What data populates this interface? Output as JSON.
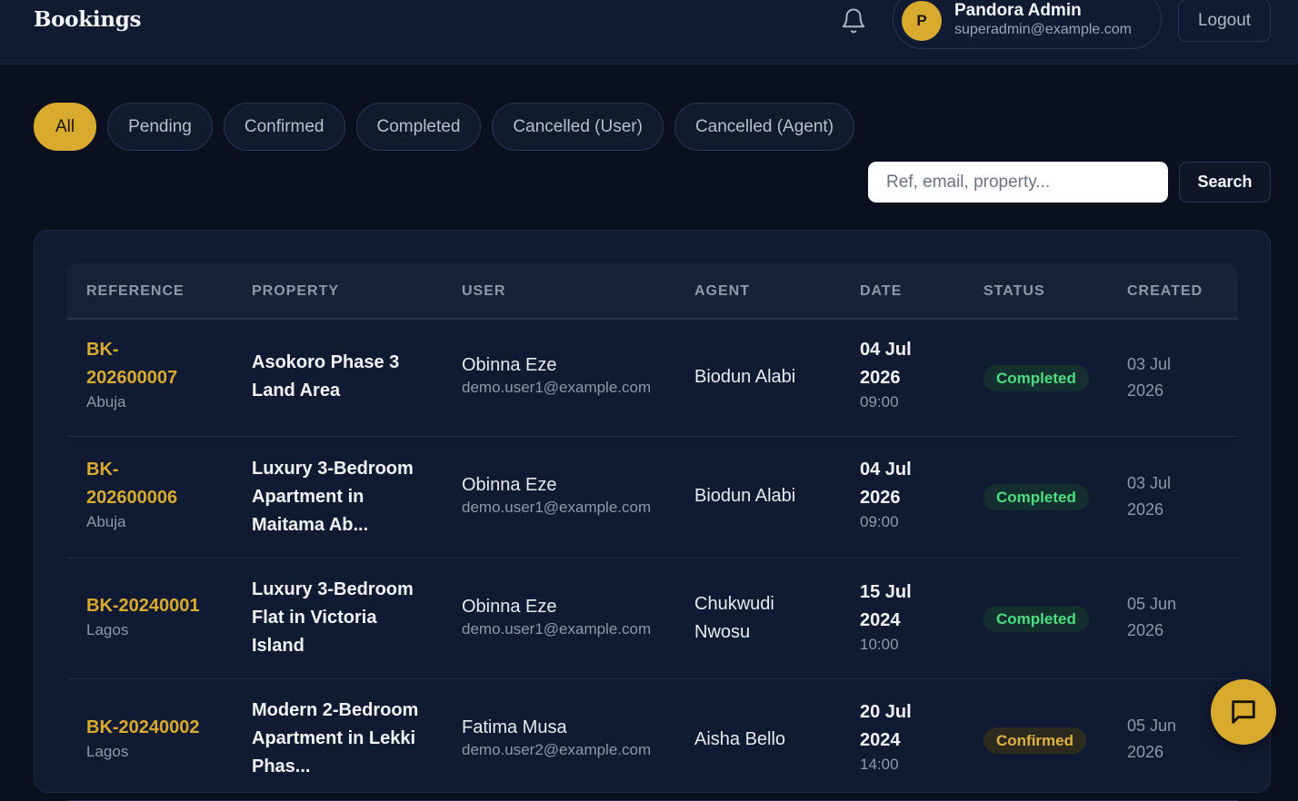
{
  "header": {
    "title": "Bookings",
    "user": {
      "initial": "P",
      "name": "Pandora Admin",
      "email": "superadmin@example.com"
    },
    "logout_label": "Logout"
  },
  "filters": {
    "tabs": [
      {
        "label": "All",
        "active": true
      },
      {
        "label": "Pending",
        "active": false
      },
      {
        "label": "Confirmed",
        "active": false
      },
      {
        "label": "Completed",
        "active": false
      },
      {
        "label": "Cancelled (User)",
        "active": false
      },
      {
        "label": "Cancelled (Agent)",
        "active": false
      }
    ]
  },
  "search": {
    "placeholder": "Ref, email, property...",
    "value": "",
    "button_label": "Search"
  },
  "table": {
    "columns": [
      "REFERENCE",
      "PROPERTY",
      "USER",
      "AGENT",
      "DATE",
      "STATUS",
      "CREATED"
    ],
    "rows": [
      {
        "ref_line1": "BK-",
        "ref_line2": "202600007",
        "city": "Abuja",
        "property_line1": "Asokoro Phase 3",
        "property_line2": "Land Area",
        "property_line3": "",
        "user_name": "Obinna Eze",
        "user_email": "demo.user1@example.com",
        "agent_line1": "Biodun Alabi",
        "agent_line2": "",
        "date_line1": "04 Jul",
        "date_line2": "2026",
        "time": "09:00",
        "status": "Completed",
        "created_line1": "03 Jul",
        "created_line2": "2026"
      },
      {
        "ref_line1": "BK-",
        "ref_line2": "202600006",
        "city": "Abuja",
        "property_line1": "Luxury 3-Bedroom",
        "property_line2": "Apartment in",
        "property_line3": "Maitama Ab...",
        "user_name": "Obinna Eze",
        "user_email": "demo.user1@example.com",
        "agent_line1": "Biodun Alabi",
        "agent_line2": "",
        "date_line1": "04 Jul",
        "date_line2": "2026",
        "time": "09:00",
        "status": "Completed",
        "created_line1": "03 Jul",
        "created_line2": "2026"
      },
      {
        "ref_line1": "BK-20240001",
        "ref_line2": "",
        "city": "Lagos",
        "property_line1": "Luxury 3-Bedroom",
        "property_line2": "Flat in Victoria",
        "property_line3": "Island",
        "user_name": "Obinna Eze",
        "user_email": "demo.user1@example.com",
        "agent_line1": "Chukwudi",
        "agent_line2": "Nwosu",
        "date_line1": "15 Jul",
        "date_line2": "2024",
        "time": "10:00",
        "status": "Completed",
        "created_line1": "05 Jun",
        "created_line2": "2026"
      },
      {
        "ref_line1": "BK-20240002",
        "ref_line2": "",
        "city": "Lagos",
        "property_line1": "Modern 2-Bedroom",
        "property_line2": "Apartment in Lekki",
        "property_line3": "Phas...",
        "user_name": "Fatima Musa",
        "user_email": "demo.user2@example.com",
        "agent_line1": "Aisha Bello",
        "agent_line2": "",
        "date_line1": "20 Jul",
        "date_line2": "2024",
        "time": "14:00",
        "status": "Confirmed",
        "created_line1": "05 Jun",
        "created_line2": "2026"
      }
    ]
  },
  "icons": {
    "notifications": "bell-icon",
    "chat": "chat-bubble-icon"
  },
  "colors": {
    "accent": "#d8aa2e",
    "background": "#0b1020",
    "surface": "#111a33",
    "status_completed": "#4ade80",
    "status_confirmed": "#e0b23a"
  }
}
